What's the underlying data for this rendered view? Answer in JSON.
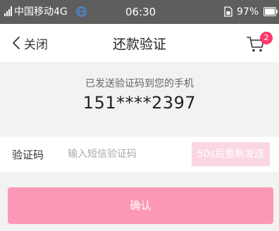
{
  "status_bar": {
    "carrier": "中国移动4G",
    "time": "06:30",
    "battery": "97%"
  },
  "nav": {
    "back_label": "关闭",
    "title": "还款验证",
    "cart_badge": "2"
  },
  "info": {
    "message": "已发送验证码到您的手机",
    "phone": "151****2397"
  },
  "code": {
    "label": "验证码",
    "placeholder": "输入短信验证码",
    "resend_label": "50s后重新发送"
  },
  "confirm_label": "确认",
  "colors": {
    "status_bar_bg": "#5e5e5e",
    "accent": "#fc98b5",
    "accent_light": "#fbd7e1",
    "badge": "#ff3a6a"
  },
  "icons": {
    "back": "chevron-left-icon",
    "cart": "cart-icon",
    "signal": "signal-icon",
    "network": "globe-icon",
    "sim": "sim-icon",
    "battery": "battery-icon"
  }
}
